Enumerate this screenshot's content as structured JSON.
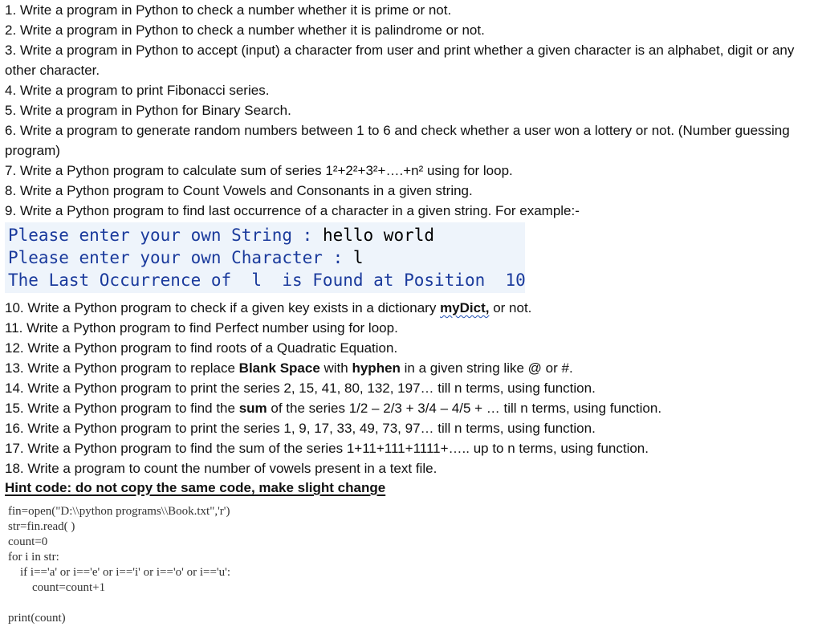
{
  "questions": [
    "1. Write a program in Python to check a number whether it is prime or not.",
    "2. Write a program in Python to check a number whether it is palindrome or not.",
    "3. Write a program in Python to accept (input) a character from user and print whether a given character is an alphabet, digit or any other character.",
    "4. Write a program to print Fibonacci series.",
    "5. Write a program in Python for Binary Search.",
    "6. Write a program to generate random numbers between 1 to 6 and check whether a user won a lottery or not. (Number guessing program)",
    "7. Write a Python program to calculate sum of series 1²+2²+3²+….+n² using for loop.",
    "8. Write a Python program to Count Vowels and Consonants in a given string.",
    "9. Write a Python program to find last occurrence of a character in a given string. For example:-"
  ],
  "example": {
    "line1_label": "Please enter your own String : ",
    "line1_value": "hello world",
    "line2_label": "Please enter your own Character : ",
    "line2_value": "l",
    "line3": "The Last Occurrence of  l  is Found at Position  10"
  },
  "questions2": {
    "q10_pre": "10. Write a Python program to check if a given key exists in a dictionary ",
    "q10_bold": "myDict,",
    "q10_post": " or not.",
    "q11": "11. Write a Python program to find Perfect number using for loop.",
    "q12": "12. Write a Python program to find roots of a Quadratic Equation.",
    "q13_pre": "13. Write a Python program to replace ",
    "q13_bold1": "Blank Space",
    "q13_mid": " with ",
    "q13_bold2": "hyphen",
    "q13_post": " in a given string like @ or #.",
    "q14": "14. Write a Python program to print the series 2, 15, 41, 80, 132, 197… till n terms, using function.",
    "q15_pre": "15. Write a Python program to find the ",
    "q15_bold": "sum",
    "q15_post": " of the series 1/2 – 2/3 + 3/4 – 4/5 + … till n terms, using function.",
    "q16": "16. Write a Python program to print the series 1, 9, 17, 33, 49, 73, 97… till n terms, using function.",
    "q17": "17. Write a Python program to find the sum of the series 1+11+111+1111+….. up to n terms, using function.",
    "q18": "18. Write a program to count the number of vowels present in a text file."
  },
  "hint": "Hint code: do not copy the same code, make slight change",
  "code_lines": [
    "fin=open(\"D:\\\\python programs\\\\Book.txt\",'r')",
    "str=fin.read( )",
    "count=0",
    "for i in str:",
    "    if i=='a' or i=='e' or i=='i' or i=='o' or i=='u':",
    "        count=count+1",
    "",
    "print(count)"
  ]
}
